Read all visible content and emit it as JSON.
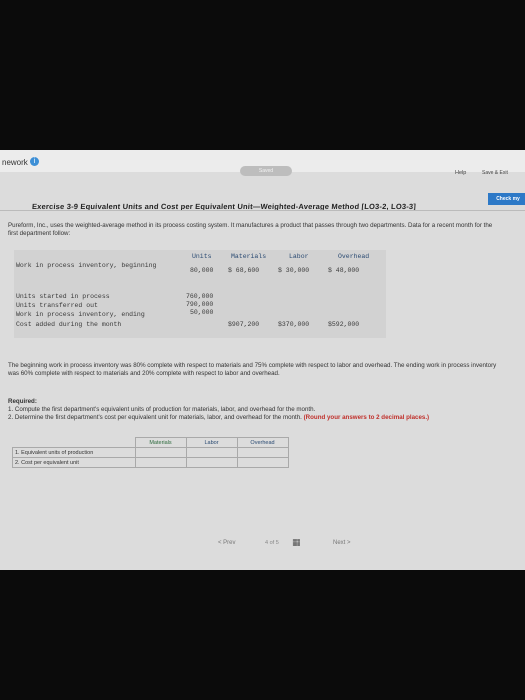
{
  "header": {
    "title": "nework",
    "info_icon": "info-icon",
    "saved": "Saved",
    "help": "Help",
    "save_exit": "Save & Exit",
    "check": "Check my"
  },
  "exercise": {
    "title": "Exercise 3-9 Equivalent Units and Cost per Equivalent Unit—Weighted-Average Method [LO3-2, LO3-3]",
    "intro": "Pureform, Inc., uses the weighted-average method in its process costing system. It manufactures a product that passes through two departments. Data for a recent month for the first department follow:"
  },
  "table": {
    "headers": [
      "Units",
      "Materials",
      "Labor",
      "Overhead"
    ],
    "rows": [
      {
        "label": "Work in process inventory, beginning",
        "units": "80,000",
        "materials": "$ 68,600",
        "labor": "$ 30,000",
        "overhead": "$ 48,000"
      },
      {
        "label": "Units started in process",
        "units": "760,000",
        "materials": "",
        "labor": "",
        "overhead": ""
      },
      {
        "label": "Units transferred out",
        "units": "790,000",
        "materials": "",
        "labor": "",
        "overhead": ""
      },
      {
        "label": "Work in process inventory, ending",
        "units": "50,000",
        "materials": "",
        "labor": "",
        "overhead": ""
      },
      {
        "label": "Cost added during the month",
        "units": "",
        "materials": "$907,200",
        "labor": "$370,000",
        "overhead": "$592,000"
      }
    ]
  },
  "paragraph": "The beginning work in process inventory was 80% complete with respect to materials and 75% complete with respect to labor and overhead. The ending work in process inventory was 60% complete with respect to materials and 20% complete with respect to labor and overhead.",
  "required": {
    "heading": "Required:",
    "item1": "1. Compute the first department's equivalent units of production for materials, labor, and overhead for the month.",
    "item2": "2. Determine the first department's cost per equivalent unit for materials, labor, and overhead for the month.",
    "note": "(Round your answers to 2 decimal places.)"
  },
  "answer_table": {
    "headers": [
      "Materials",
      "Labor",
      "Overhead"
    ],
    "rows": [
      "1. Equivalent units of production",
      "2. Cost per equivalent unit"
    ]
  },
  "pagination": {
    "prev": "< Prev",
    "current": "4",
    "of": "of",
    "total": "5",
    "next": "Next >"
  }
}
